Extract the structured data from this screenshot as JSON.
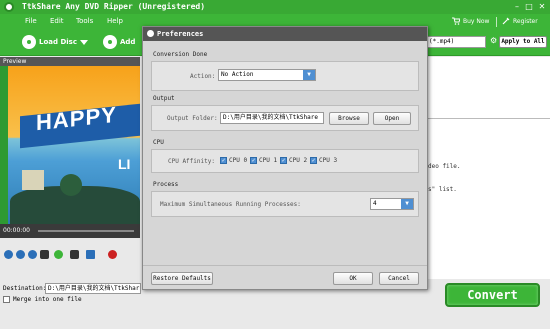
{
  "app": {
    "title": "TtkShare Any DVD Ripper (Unregistered)",
    "menu": [
      "File",
      "Edit",
      "Tools",
      "Help"
    ],
    "buy_now": "Buy Now",
    "register": "Register",
    "load_disc": "Load Disc",
    "add": "Add",
    "profile_value": "(*.mp4)",
    "apply_to_all": "Apply to All",
    "hint_1": "deo file.",
    "hint_2": "s\" list.",
    "preview_label": "Preview",
    "preview_overlay_1": "HAPPY",
    "preview_overlay_2": "LI",
    "time": "00:00:00",
    "destination_label": "Destination:",
    "destination_value": "D:\\用户目录\\我的文档\\TtkShar",
    "merge_label": "Merge into one file",
    "convert": "Convert"
  },
  "dialog": {
    "title": "Preferences",
    "conversion_done": {
      "title": "Conversion Done",
      "action_label": "Action:",
      "action_value": "No Action"
    },
    "output": {
      "title": "Output",
      "folder_label": "Output Folder:",
      "folder_value": "D:\\用户目录\\我的文档\\TtkShare",
      "browse": "Browse",
      "open": "Open"
    },
    "cpu": {
      "title": "CPU",
      "affinity_label": "CPU Affinity:",
      "cores": [
        "CPU 0",
        "CPU 1",
        "CPU 2",
        "CPU 3"
      ]
    },
    "process": {
      "title": "Process",
      "max_label": "Maximum Simultaneous Running Processes:",
      "max_value": "4"
    },
    "restore_defaults": "Restore Defaults",
    "ok": "OK",
    "cancel": "Cancel"
  }
}
